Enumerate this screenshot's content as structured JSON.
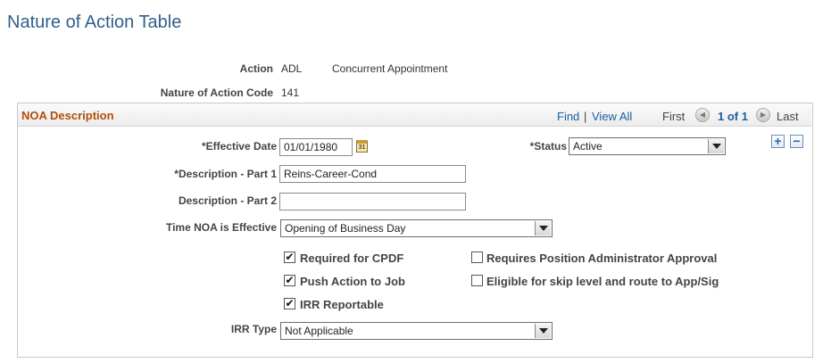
{
  "page": {
    "title": "Nature of Action Table"
  },
  "header": {
    "action_label": "Action",
    "action_code": "ADL",
    "action_desc": "Concurrent Appointment",
    "noa_code_label": "Nature of Action Code",
    "noa_code": "141"
  },
  "section": {
    "title": "NOA Description",
    "find": "Find",
    "separator": "|",
    "view_all": "View All",
    "first": "First",
    "counter": "1 of 1",
    "last": "Last"
  },
  "form": {
    "effective_date_label": "*Effective Date",
    "effective_date_value": "01/01/1980",
    "calendar_icon_text": "31",
    "status_label": "*Status",
    "status_value": "Active",
    "desc1_label": "*Description - Part 1",
    "desc1_value": "Reins-Career-Cond",
    "desc2_label": "Description - Part 2",
    "desc2_value": "",
    "time_label": "Time NOA is Effective",
    "time_value": "Opening of Business Day",
    "irr_type_label": "IRR Type",
    "irr_type_value": "Not Applicable"
  },
  "checkboxes": {
    "required_cpdf": {
      "label": "Required for CPDF",
      "checked": true
    },
    "push_action": {
      "label": "Push Action to Job",
      "checked": true
    },
    "irr_reportable": {
      "label": "IRR Reportable",
      "checked": true
    },
    "requires_pos_admin": {
      "label": "Requires Position Administrator Approval",
      "checked": false
    },
    "eligible_skip": {
      "label": "Eligible for skip level and route to App/Sig",
      "checked": false
    }
  },
  "icons": {
    "add": "plus-icon",
    "delete": "minus-icon",
    "calendar": "calendar-icon",
    "dropdown": "chevron-down-icon",
    "prev": "previous-arrow-icon",
    "next": "next-arrow-icon"
  },
  "colors": {
    "title": "#2f5f8c",
    "section_title": "#b24e0a",
    "link": "#1c5ea0"
  }
}
